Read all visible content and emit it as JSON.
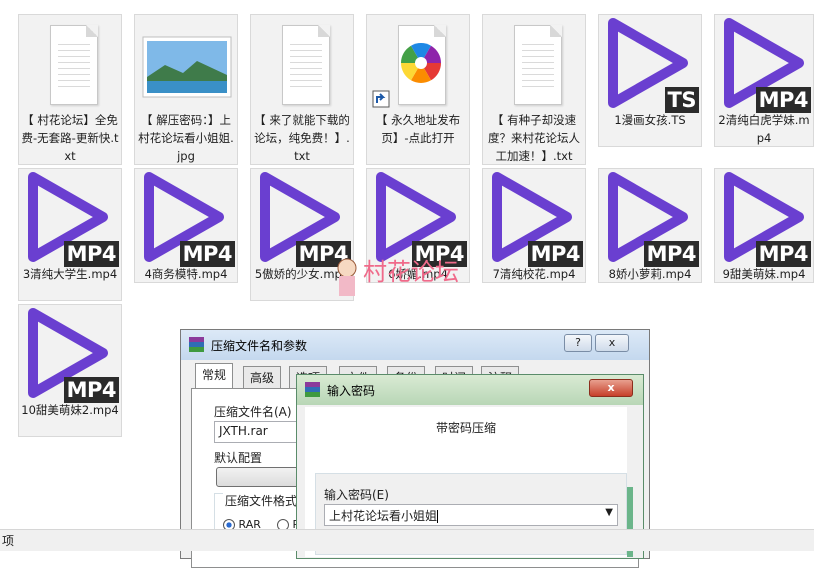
{
  "files": [
    {
      "name": "【 村花论坛】全免费-无套路-更新快.txt",
      "kind": "txt"
    },
    {
      "name": "【 解压密码：】上村花论坛看小姐姐.jpg",
      "kind": "jpg"
    },
    {
      "name": "【 来了就能下载的论坛，纯免费！】.txt",
      "kind": "txt"
    },
    {
      "name": "【 永久地址发布页】-点此打开",
      "kind": "shortcut"
    },
    {
      "name": "【 有种子却没速度？来村花论坛人工加速！】.txt",
      "kind": "txt"
    },
    {
      "name": "1漫画女孩.TS",
      "kind": "video",
      "badge": "TS"
    },
    {
      "name": "2清纯白虎学妹.mp4",
      "kind": "video",
      "badge": "MP4"
    },
    {
      "name": "3清纯大学生.mp4",
      "kind": "video",
      "badge": "MP4"
    },
    {
      "name": "4商务模特.mp4",
      "kind": "video",
      "badge": "MP4"
    },
    {
      "name": "5傲娇的少女.mp4",
      "kind": "video",
      "badge": "MP4"
    },
    {
      "name": "6娇媚.mp4",
      "kind": "video",
      "badge": "MP4"
    },
    {
      "name": "7清纯校花.mp4",
      "kind": "video",
      "badge": "MP4"
    },
    {
      "name": "8娇小萝莉.mp4",
      "kind": "video",
      "badge": "MP4"
    },
    {
      "name": "9甜美萌妹.mp4",
      "kind": "video",
      "badge": "MP4"
    },
    {
      "name": "10甜美萌妹2.mp4",
      "kind": "video",
      "badge": "MP4"
    }
  ],
  "watermark": {
    "text": "村花论坛"
  },
  "compress_dialog": {
    "title": "压缩文件名和参数",
    "help_btn": "?",
    "close_btn": "x",
    "tabs": [
      "常规",
      "高级",
      "选项",
      "文件",
      "备份",
      "时间",
      "注释"
    ],
    "filename_label": "压缩文件名(A)",
    "filename_value": "JXTH.rar",
    "default_config_label": "默认配置",
    "config_button": "配置文",
    "format_group_label": "压缩文件格式",
    "format_options": [
      "RAR",
      "R"
    ]
  },
  "password_dialog": {
    "title": "输入密码",
    "close_btn": "x",
    "heading": "带密码压缩",
    "password_label": "输入密码(E)",
    "password_value": "上村花论坛看小姐姐"
  },
  "statusbar": {
    "text": "项"
  },
  "colors": {
    "video_play": "#6a3fd0",
    "badge_bg": "#2b2b2b",
    "title_accent": "#dce9f7"
  }
}
